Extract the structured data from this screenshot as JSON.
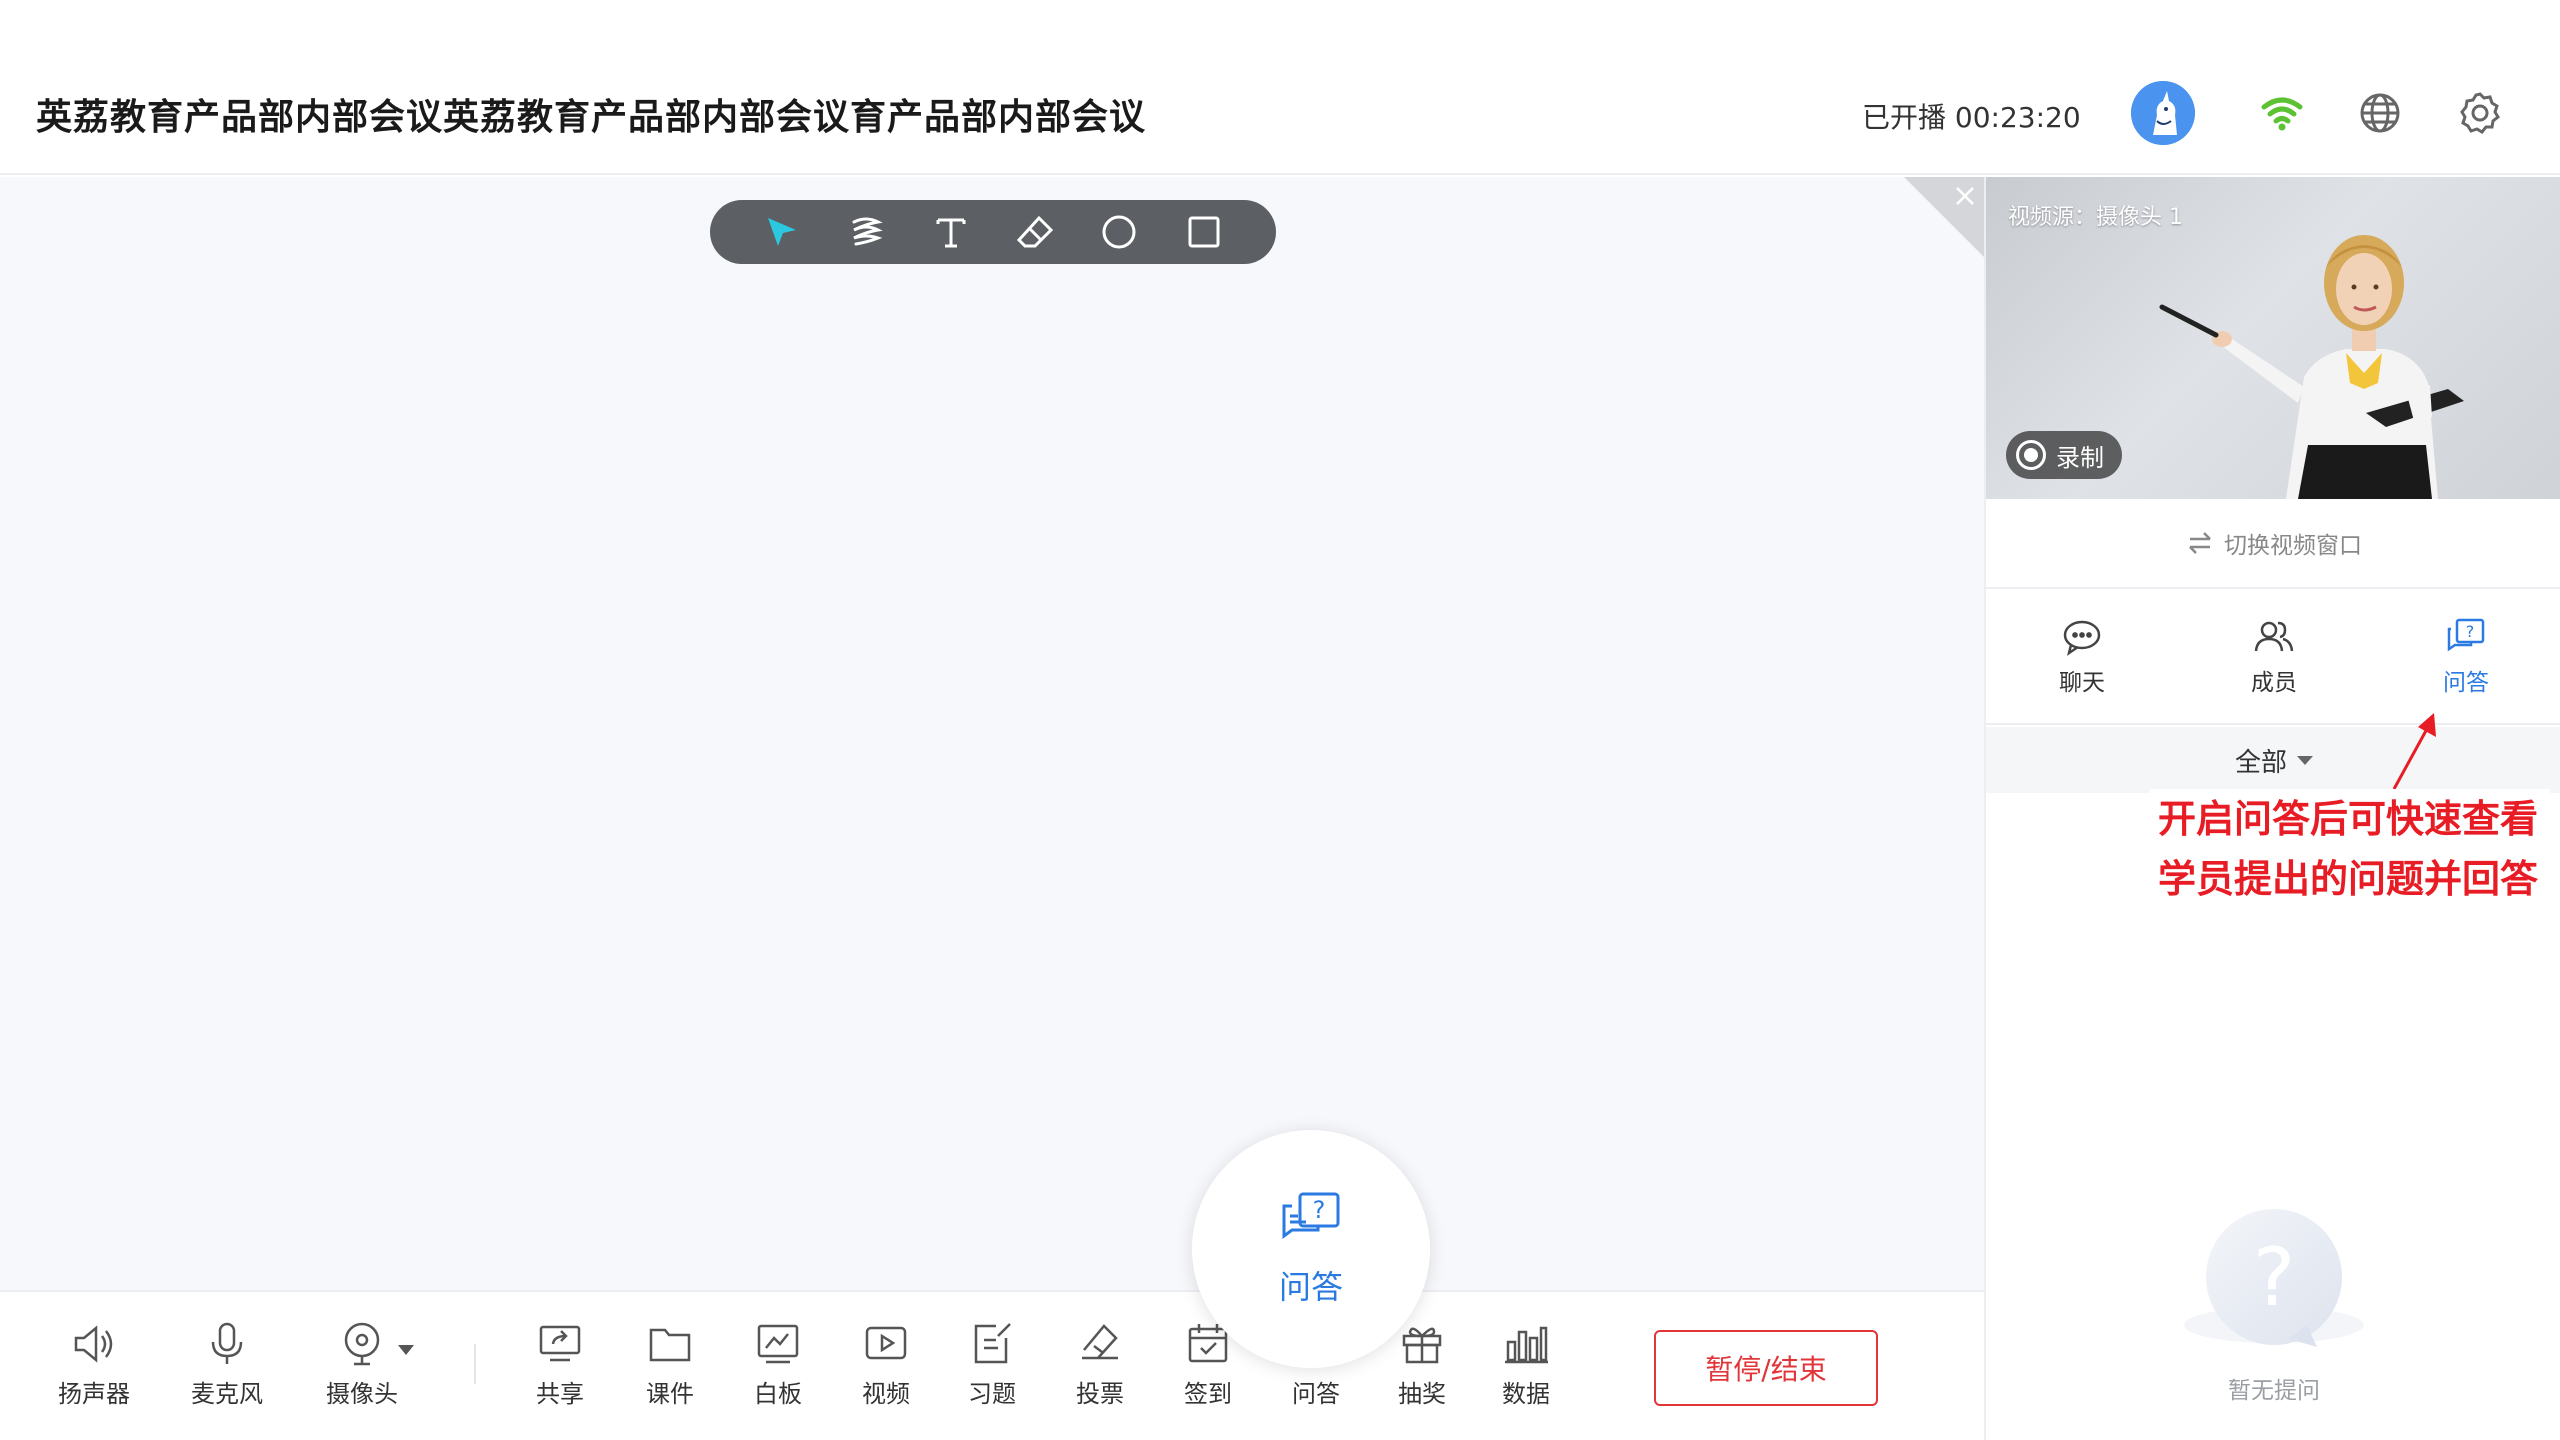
{
  "header": {
    "title": "英荔教育产品部内部会议英荔教育产品部内部会议育产品部内部会议",
    "live_status": "已开播 00:23:20"
  },
  "video": {
    "source_label": "视频源：摄像头 1",
    "record_label": "录制",
    "switch_label": "切换视频窗口"
  },
  "side_tabs": [
    {
      "label": "聊天",
      "icon": "chat-icon"
    },
    {
      "label": "成员",
      "icon": "members-icon"
    },
    {
      "label": "问答",
      "icon": "qa-icon",
      "active": true
    }
  ],
  "filter": {
    "label": "全部"
  },
  "annotation": {
    "line1": "开启问答后可快速查看",
    "line2": "学员提出的问题并回答"
  },
  "empty_state": {
    "text": "暂无提问"
  },
  "toolbar_tools": [
    "pointer-icon",
    "pen-icon",
    "text-icon",
    "eraser-icon",
    "circle-icon",
    "rectangle-icon"
  ],
  "bottom": {
    "speaker": "扬声器",
    "mic": "麦克风",
    "camera": "摄像头",
    "share": "共享",
    "courseware": "课件",
    "whiteboard": "白板",
    "video": "视频",
    "exercise": "习题",
    "vote": "投票",
    "checkin": "签到",
    "qa": "问答",
    "lottery": "抽奖",
    "data": "数据",
    "end_button": "暂停/结束"
  },
  "bubble": {
    "label": "问答"
  },
  "colors": {
    "accent": "#2a7ae2",
    "danger": "#e2353a",
    "annotation": "#e81c24"
  }
}
